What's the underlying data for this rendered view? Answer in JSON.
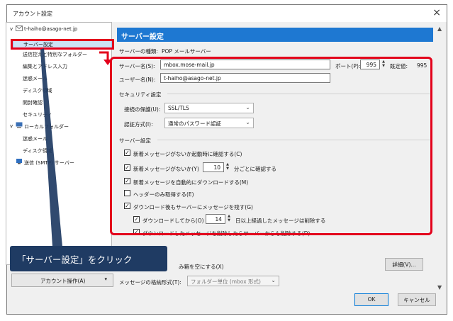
{
  "window": {
    "title": "アカウント設定",
    "close": "×"
  },
  "tree": {
    "account": "t-haiho@asago-net.jp",
    "items": [
      "サーバー設定",
      "送信控えと特別なフォルダー",
      "編集とアドレス入力",
      "迷惑メール",
      "ディスク領域",
      "開封確認",
      "セキュリティ"
    ],
    "local_folders": "ローカルフォルダー",
    "local_items": [
      "迷惑メール",
      "ディスク領域"
    ],
    "smtp": "送信 (SMTP) サーバー"
  },
  "account_actions": {
    "label": "アカウント操作(A)",
    "arrow": "▾"
  },
  "panel": {
    "heading": "サーバー設定",
    "server_type_label": "サーバーの種類:",
    "server_type_value": "POP メールサーバー",
    "server_name_label": "サーバー名(S):",
    "server_name_value": "mbox.mose-mail.jp",
    "port_label": "ポート(P):",
    "port_value": "995",
    "default_label": "既定値:",
    "default_value": "995",
    "username_label": "ユーザー名(N):",
    "username_value": "t-haiho@asago-net.jp",
    "security_group": "セキュリティ設定",
    "conn_security_label": "接続の保護(U):",
    "conn_security_value": "SSL/TLS",
    "auth_label": "認証方式(I):",
    "auth_value": "通常のパスワード認証",
    "server_group": "サーバー設定",
    "check_startup": "新着メッセージがないか起動時に確認する(C)",
    "check_every_prefix": "新着メッセージがないか(Y)",
    "check_every_value": "10",
    "check_every_suffix": "分ごとに確認する",
    "auto_download": "新着メッセージを自動的にダウンロードする(M)",
    "headers_only": "ヘッダーのみ取得する(E)",
    "leave_on_server": "ダウンロード後もサーバーにメッセージを残す(G)",
    "delete_after_prefix": "ダウンロードしてから(O)",
    "delete_after_value": "14",
    "delete_after_suffix": "日以上経過したメッセージは削除する",
    "delete_when_deleted": "ダウンロードしたメッセージを削除したらサーバーからも削除する(D)",
    "empty_trash_suffix": "み箱を空にする(X)",
    "advanced_button": "詳細(V)...",
    "storage_label": "メッセージの格納形式(T):",
    "storage_value": "フォルダー単位 (mbox 形式)"
  },
  "buttons": {
    "ok": "OK",
    "cancel": "キャンセル"
  },
  "callout": {
    "text": "「サーバー設定」をクリック"
  },
  "colors": {
    "highlight": "#e3001b",
    "header": "#1e78d2",
    "callout": "#1f3b63"
  },
  "icons": [
    "mail-account-icon",
    "folder-icon",
    "smtp-icon",
    "spinner-icon",
    "dropdown-icon",
    "close-icon"
  ]
}
